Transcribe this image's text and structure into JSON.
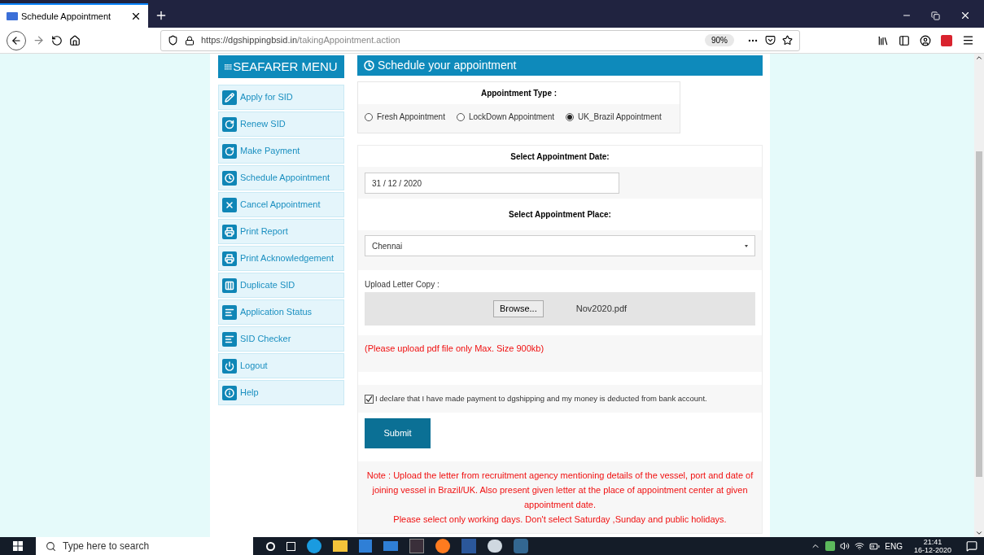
{
  "browser": {
    "tab_title": "Schedule Appointment",
    "url_host": "https://dgshippingbsid.in",
    "url_path": "/takingAppointment.action",
    "zoom": "90%"
  },
  "sidebar": {
    "title": "SEAFARER MENU",
    "items": [
      {
        "label": "Apply for SID",
        "kind": "pencil"
      },
      {
        "label": "Renew SID",
        "kind": "refresh"
      },
      {
        "label": "Make Payment",
        "kind": "refresh"
      },
      {
        "label": "Schedule Appointment",
        "kind": "clock"
      },
      {
        "label": "Cancel Appointment",
        "kind": "cross"
      },
      {
        "label": "Print Report",
        "kind": "printer"
      },
      {
        "label": "Print Acknowledgement",
        "kind": "printer"
      },
      {
        "label": "Duplicate SID",
        "kind": "columns"
      },
      {
        "label": "Application Status",
        "kind": "list"
      },
      {
        "label": "SID Checker",
        "kind": "list"
      },
      {
        "label": "Logout",
        "kind": "power"
      },
      {
        "label": "Help",
        "kind": "info"
      }
    ]
  },
  "form": {
    "title": "Schedule your appointment",
    "appointment_type": {
      "label": "Appointment Type :",
      "options": [
        {
          "label": "Fresh Appointment",
          "selected": false
        },
        {
          "label": "LockDown Appointment",
          "selected": false
        },
        {
          "label": "UK_Brazil Appointment",
          "selected": true
        }
      ]
    },
    "date": {
      "label": "Select Appointment Date:",
      "value": "31 / 12 / 2020"
    },
    "place": {
      "label": "Select Appointment Place:",
      "value": "Chennai"
    },
    "upload": {
      "label": "Upload Letter Copy :",
      "button": "Browse...",
      "filename": "Nov2020.pdf"
    },
    "hint": "(Please upload pdf file only Max. Size 900kb)",
    "declaration": {
      "text": "I declare that I have made payment to dgshipping and my money is deducted from bank account.",
      "checked": true
    },
    "submit": "Submit",
    "notes": [
      "Note : Upload the letter from recruitment agency mentioning details of the vessel, port and date of joining vessel in Brazil/UK. Also present given letter at the place of appointment center at given appointment date.",
      "Please select only working days. Don't select Saturday ,Sunday and public holidays."
    ]
  },
  "taskbar": {
    "search_placeholder": "Type here to search",
    "language": "ENG",
    "time": "21:41",
    "date": "16-12-2020"
  }
}
